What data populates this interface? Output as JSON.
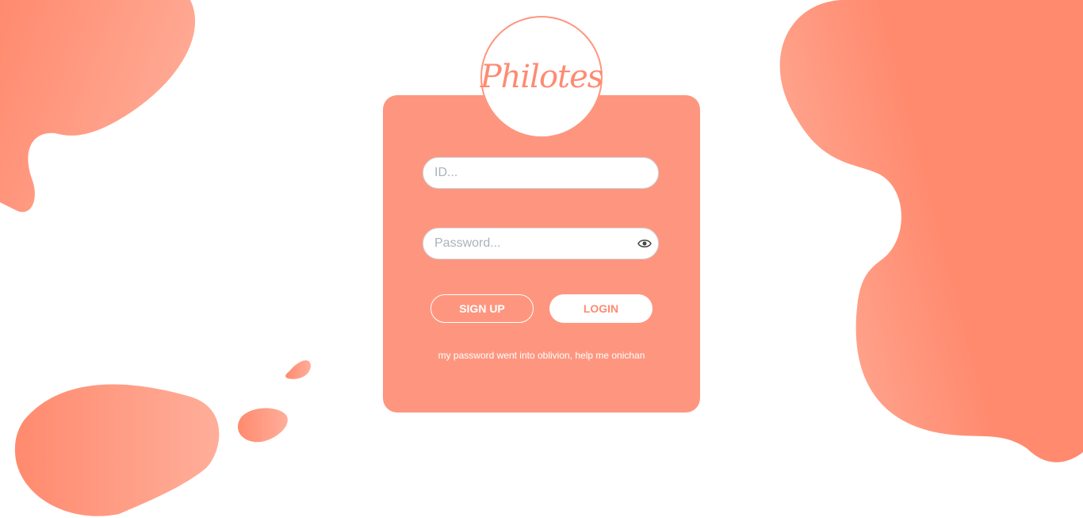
{
  "brand": {
    "logo_text": "Philotes",
    "accent": "#fe967f"
  },
  "form": {
    "id_placeholder": "ID...",
    "password_placeholder": "Password...",
    "password_toggle_icon": "eye-icon",
    "signup_label": "SIGN UP",
    "login_label": "LOGIN",
    "forgot_link": "my password went into oblivion, help me onichan"
  }
}
